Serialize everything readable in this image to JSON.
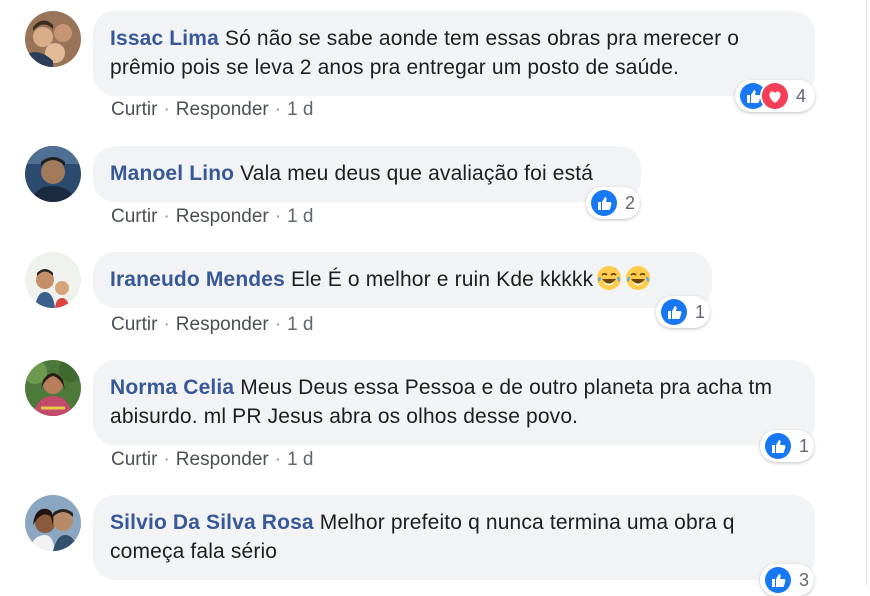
{
  "comments": [
    {
      "author": "Issac Lima",
      "text": "Só não se sabe aonde tem essas obras pra merecer o prêmio pois se leva 2 anos pra entregar um posto de saúde.",
      "actions": {
        "like": "Curtir",
        "reply": "Responder",
        "time": "1 d"
      },
      "reactions": {
        "types": [
          "like-icon",
          "love-icon"
        ],
        "count": "4"
      },
      "avatar_colors": [
        "#7a5a44",
        "#d8b08c"
      ]
    },
    {
      "author": "Manoel Lino",
      "text": "Vala meu deus que avaliação foi está",
      "actions": {
        "like": "Curtir",
        "reply": "Responder",
        "time": "1 d"
      },
      "reactions": {
        "types": [
          "like-icon"
        ],
        "count": "2"
      },
      "avatar_colors": [
        "#2b4a6e",
        "#a27b5c"
      ]
    },
    {
      "author": "Iraneudo Mendes",
      "text": "Ele É o melhor e ruin Kde kkkkk",
      "emoji": [
        "laughing-tears-emoji",
        "laughing-tears-emoji"
      ],
      "actions": {
        "like": "Curtir",
        "reply": "Responder",
        "time": "1 d"
      },
      "reactions": {
        "types": [
          "like-icon"
        ],
        "count": "1"
      },
      "avatar_colors": [
        "#e8ece6",
        "#c48e67"
      ]
    },
    {
      "author": "Norma Celia",
      "text": "Meus Deus essa Pessoa e de outro planeta pra acha tm abisurdo. ml PR Jesus abra os olhos desse povo.",
      "actions": {
        "like": "Curtir",
        "reply": "Responder",
        "time": "1 d"
      },
      "reactions": {
        "types": [
          "like-icon"
        ],
        "count": "1"
      },
      "avatar_colors": [
        "#4d7a3a",
        "#c24a6a"
      ]
    },
    {
      "author": "Silvio Da Silva Rosa",
      "text": "Melhor prefeito q nunca termina uma obra q começa fala sério",
      "actions": null,
      "reactions": {
        "types": [
          "like-icon"
        ],
        "count": "3"
      },
      "avatar_colors": [
        "#6a8aa8",
        "#8a5a3c"
      ]
    }
  ],
  "colors": {
    "author": "#385898",
    "bubble": "#f2f3f5",
    "like": "#1877f2",
    "love": "#f33e58",
    "meta": "#616770"
  }
}
